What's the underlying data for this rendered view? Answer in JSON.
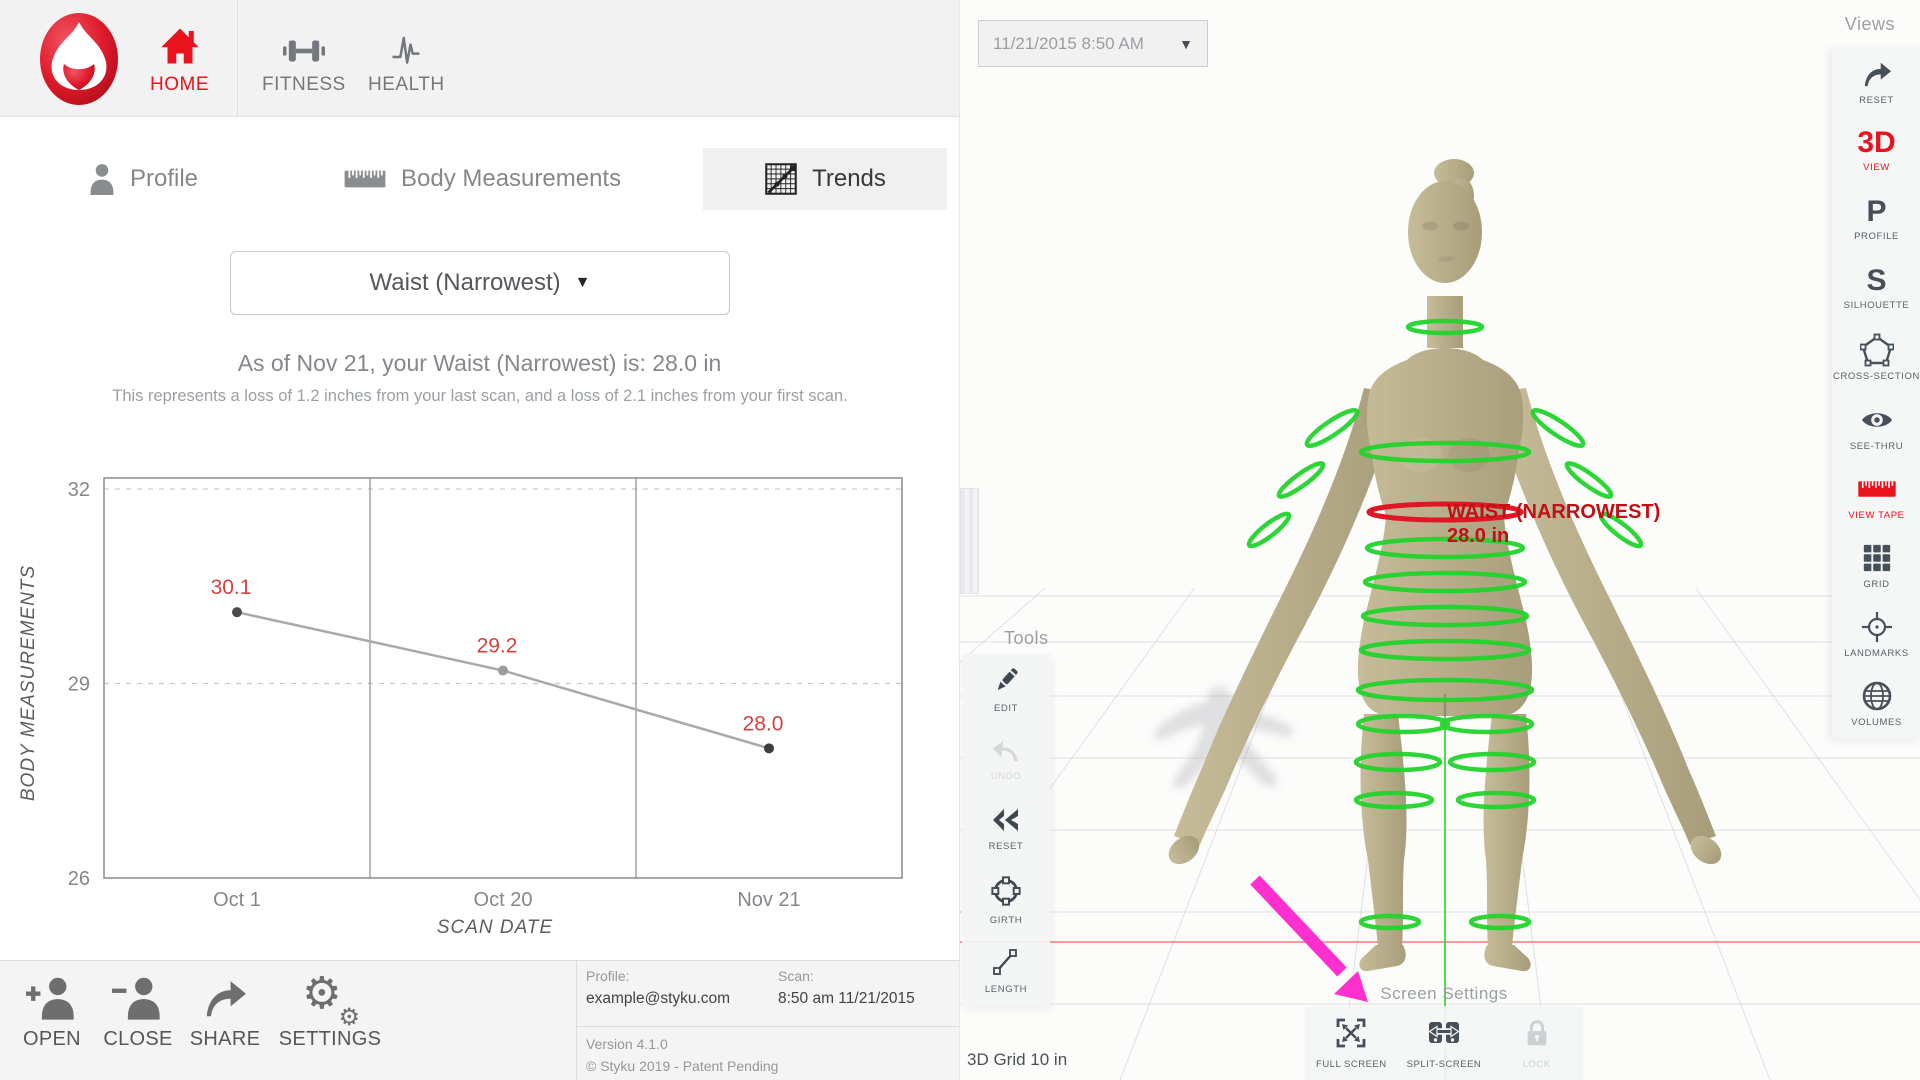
{
  "colors": {
    "accent_red": "#e8131d",
    "chart_value_red": "#d5413e",
    "annotation_red": "#bf1016",
    "ring_green": "#22d42c",
    "ring_red": "#e01525",
    "magenta_arrow": "#ff2fd0",
    "body_tan": "#b7ad8a",
    "icon_slate": "#474f58",
    "disabled_gray": "#cdd0d3"
  },
  "nav": {
    "home": "HOME",
    "fitness": "FITNESS",
    "health": "HEALTH"
  },
  "tabs": {
    "profile": "Profile",
    "body_measurements": "Body Measurements",
    "trends": "Trends"
  },
  "measurement_select": {
    "value": "Waist (Narrowest)",
    "caret": "▼"
  },
  "summary": {
    "heading": "As of Nov 21, your Waist (Narrowest) is: 28.0 in",
    "detail": "This represents a loss of 1.2 inches from your last scan, and a loss of 2.1 inches from your first scan."
  },
  "chart_data": {
    "type": "line",
    "series_name": "Waist (Narrowest)",
    "x": [
      "Oct 1",
      "Oct 20",
      "Nov 21"
    ],
    "values": [
      30.1,
      29.2,
      28.0
    ],
    "point_labels": [
      "30.1",
      "29.2",
      "28.0"
    ],
    "xlabel": "SCAN DATE",
    "ylabel": "BODY MEASUREMENTS",
    "yticks": [
      32,
      29,
      26
    ],
    "ylim": [
      26,
      32
    ],
    "grid": "dashed-horizontal",
    "units": "in",
    "legend": "none"
  },
  "toolbar": {
    "open": "OPEN",
    "close": "CLOSE",
    "share": "SHARE",
    "settings": "SETTINGS"
  },
  "session": {
    "profile_label": "Profile:",
    "profile_value": "example@styku.com",
    "scan_label": "Scan:",
    "scan_value": "8:50 am 11/21/2015",
    "version": "Version 4.1.0",
    "copyright": "© Styku 2019 - Patent Pending"
  },
  "viewer": {
    "date_select": {
      "value": "11/21/2015 8:50 AM",
      "caret": "▼"
    },
    "views_title": "Views",
    "views": {
      "reset": "RESET",
      "view3d_glyph": "3D",
      "view3d": "VIEW",
      "profile_glyph": "P",
      "profile": "PROFILE",
      "silhouette_glyph": "S",
      "silhouette": "SILHOUETTE",
      "cross_section": "CROSS-SECTION",
      "see_thru": "SEE-THRU",
      "view_tape": "VIEW TAPE",
      "grid": "GRID",
      "landmarks": "LANDMARKS",
      "volumes": "VOLUMES"
    },
    "tools_title": "Tools",
    "tools": {
      "edit": "EDIT",
      "undo": "UNDO",
      "reset": "RESET",
      "girth": "GIRTH",
      "length": "LENGTH"
    },
    "screen_settings_title": "Screen Settings",
    "screen_settings": {
      "full_screen": "FULL SCREEN",
      "split_screen": "SPLIT-SCREEN",
      "lock": "LOCK"
    },
    "grid_scale_label": "3D Grid 10 in",
    "annotation": {
      "name": "WAIST (NARROWEST)",
      "value": "28.0 in"
    }
  }
}
